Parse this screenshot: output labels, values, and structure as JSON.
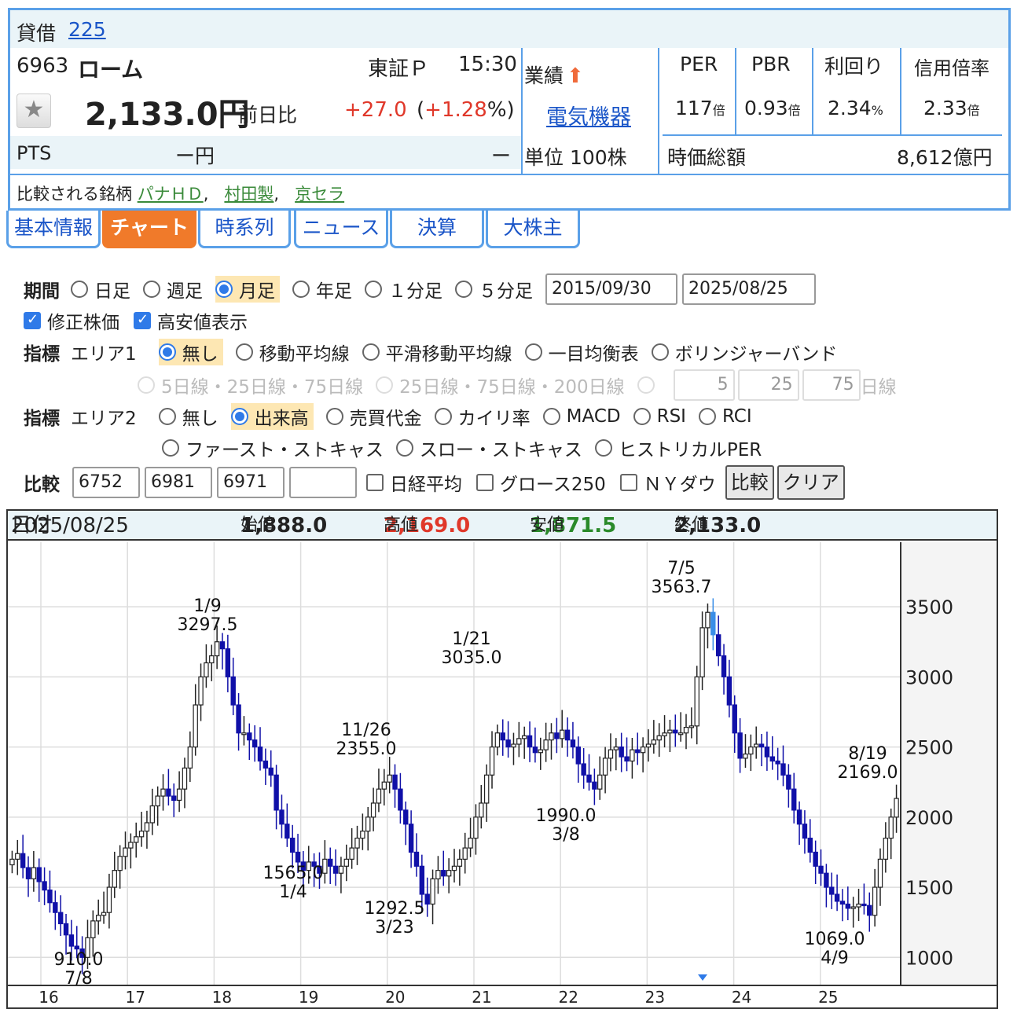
{
  "header": {
    "taishaku_label": "貸借",
    "index_link": "225",
    "code": "6963",
    "name": "ローム",
    "market": "東証Ｐ",
    "time": "15:30",
    "price": "2,133.0円",
    "change_label": "前日比",
    "change": "+27.0",
    "change_pct_open": "(",
    "change_pct": "+1.28",
    "change_pct_close": "%)",
    "pts_label": "PTS",
    "pts_price": "ー円",
    "pts_change": "ー",
    "gyoseki_label": "業績",
    "sector_link": "電気機器",
    "unit": "単位 100株",
    "metrics": [
      {
        "label": "PER",
        "value": "117",
        "unit": "倍"
      },
      {
        "label": "PBR",
        "value": "0.93",
        "unit": "倍"
      },
      {
        "label": "利回り",
        "value": "2.34",
        "unit": "%"
      },
      {
        "label": "信用倍率",
        "value": "2.33",
        "unit": "倍"
      }
    ],
    "market_cap_label": "時価総額",
    "market_cap": "8,612億円",
    "compare_label": "比較される銘柄",
    "compare_stocks": [
      "パナＨＤ",
      "村田製",
      "京セラ"
    ],
    "comma": ","
  },
  "tabs": [
    "基本情報",
    "チャート",
    "時系列",
    "ニュース",
    "決算",
    "大株主"
  ],
  "form": {
    "period_label": "期間",
    "period_options": [
      "日足",
      "週足",
      "月足",
      "年足",
      "１分足",
      "５分足"
    ],
    "date_from": "2015/09/30",
    "date_to": "2025/08/25",
    "checks": [
      "修正株価",
      "高安値表示"
    ],
    "indicator_label": "指標",
    "area1_label": "エリア1",
    "area1_options": [
      "無し",
      "移動平均線",
      "平滑移動平均線",
      "一目均衡表",
      "ボリンジャーバンド"
    ],
    "area1_sub": [
      "5日線・25日線・75日線",
      "25日線・75日線・200日線"
    ],
    "ma_values": [
      "5",
      "25",
      "75"
    ],
    "ma_unit": "日線",
    "area2_label": "エリア2",
    "area2_options": [
      "無し",
      "出来高",
      "売買代金",
      "カイリ率",
      "MACD",
      "RSI",
      "RCI",
      "ファースト・ストキャス",
      "スロー・ストキャス",
      "ヒストリカルPER"
    ],
    "compare_label": "比較",
    "compare_codes": [
      "6752",
      "6981",
      "6971",
      ""
    ],
    "compare_checks": [
      "日経平均",
      "グロース250",
      "ＮＹダウ"
    ],
    "compare_button": "比較",
    "clear_button": "クリア"
  },
  "chart_info": {
    "date_label": "日付",
    "date": "2025/08/25",
    "open_label": "始値",
    "open": "1,888.0",
    "high_label": "高値",
    "high": "2,169.0",
    "low_label": "安値",
    "low": "1,871.5",
    "close_label": "終値",
    "close": "2,133.0"
  },
  "chart_data": {
    "type": "candlestick",
    "x_ticks": [
      "16",
      "17",
      "18",
      "19",
      "20",
      "21",
      "22",
      "23",
      "24",
      "25"
    ],
    "y_ticks": [
      1000,
      1500,
      2000,
      2500,
      3000,
      3500
    ],
    "ylim": [
      800,
      3960
    ],
    "closes": [
      1700,
      1740,
      1640,
      1560,
      1640,
      1540,
      1480,
      1390,
      1320,
      1240,
      1160,
      1080,
      1060,
      1000,
      1140,
      1260,
      1300,
      1320,
      1500,
      1620,
      1720,
      1780,
      1820,
      1860,
      1900,
      1960,
      2080,
      2150,
      2200,
      2150,
      2120,
      2200,
      2350,
      2500,
      2800,
      3000,
      3100,
      3150,
      3250,
      3200,
      3000,
      2800,
      2600,
      2600,
      2550,
      2500,
      2400,
      2350,
      2300,
      2050,
      1950,
      1850,
      1750,
      1680,
      1620,
      1680,
      1650,
      1600,
      1700,
      1650,
      1600,
      1650,
      1700,
      1780,
      1850,
      1900,
      2000,
      2100,
      2200,
      2250,
      2300,
      2200,
      2050,
      1950,
      1750,
      1650,
      1450,
      1380,
      1560,
      1620,
      1580,
      1620,
      1650,
      1700,
      1780,
      1850,
      2000,
      2100,
      2300,
      2500,
      2600,
      2550,
      2500,
      2520,
      2560,
      2580,
      2500,
      2460,
      2480,
      2550,
      2600,
      2560,
      2620,
      2550,
      2500,
      2380,
      2300,
      2250,
      2200,
      2300,
      2420,
      2480,
      2500,
      2430,
      2400,
      2480,
      2460,
      2500,
      2520,
      2550,
      2580,
      2600,
      2620,
      2600,
      2600,
      2640,
      2650,
      3000,
      3350,
      3460,
      3300,
      3150,
      3000,
      2800,
      2600,
      2420,
      2450,
      2500,
      2520,
      2500,
      2430,
      2400,
      2380,
      2300,
      2200,
      2050,
      1950,
      1850,
      1750,
      1650,
      1600,
      1500,
      1450,
      1400,
      1380,
      1350,
      1360,
      1380,
      1370,
      1300,
      1500,
      1700,
      1850,
      2000,
      2133
    ],
    "annotations": [
      {
        "date": "1/9",
        "value": "3297.5",
        "type": "high"
      },
      {
        "date": "1/4",
        "value": "1565.0",
        "type": "low"
      },
      {
        "date": "11/26",
        "value": "2355.0",
        "type": "high"
      },
      {
        "date": "3/23",
        "value": "1292.5",
        "type": "low"
      },
      {
        "date": "1/21",
        "value": "3035.0",
        "type": "high"
      },
      {
        "date": "3/8",
        "value": "1990.0",
        "type": "low"
      },
      {
        "date": "7/5",
        "value": "3563.7",
        "type": "high"
      },
      {
        "date": "7/8",
        "value": "910.0",
        "type": "low"
      },
      {
        "date": "4/9",
        "value": "1069.0",
        "type": "low"
      },
      {
        "date": "8/19",
        "value": "2169.0",
        "type": "high"
      }
    ]
  }
}
